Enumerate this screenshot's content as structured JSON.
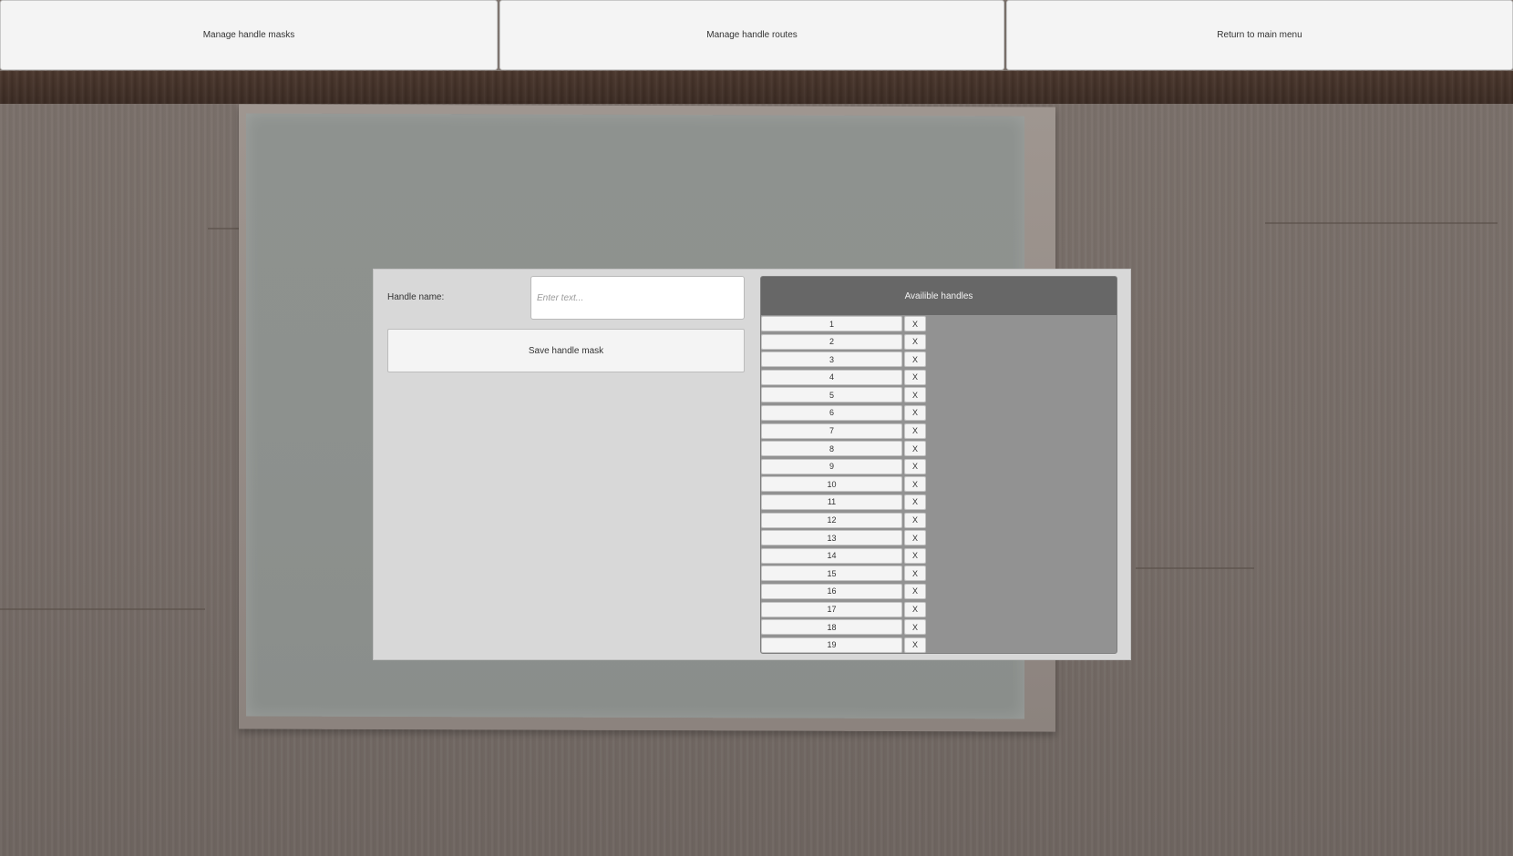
{
  "nav": {
    "manage_masks": "Manage handle masks",
    "manage_routes": "Manage handle routes",
    "return_main": "Return to main menu"
  },
  "form": {
    "handle_name_label": "Handle name:",
    "handle_name_value": "",
    "handle_name_placeholder": "Enter text...",
    "save_label": "Save handle mask"
  },
  "handles": {
    "title": "Availible handles",
    "remove_label": "X",
    "items": [
      "1",
      "2",
      "3",
      "4",
      "5",
      "6",
      "7",
      "8",
      "9",
      "10",
      "11",
      "12",
      "13",
      "14",
      "15",
      "16",
      "17",
      "18",
      "19"
    ]
  },
  "colors": {
    "button_bg": "#f4f4f4",
    "dialog_bg": "#d8d8d8",
    "panel_header_bg": "#676767",
    "panel_bg": "#929292"
  }
}
